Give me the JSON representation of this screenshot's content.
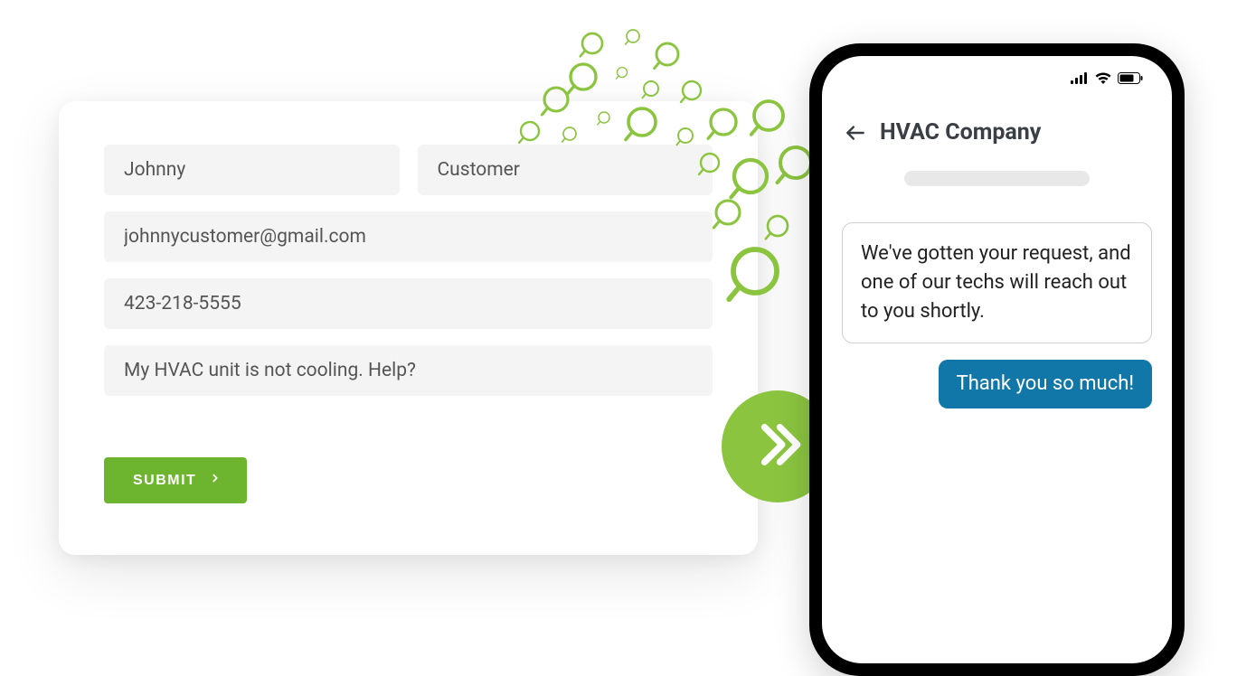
{
  "form": {
    "first_name": "Johnny",
    "last_name": "Customer",
    "email": "johnnycustomer@gmail.com",
    "phone": "423-218-5555",
    "message": "My HVAC unit is not cooling. Help?",
    "submit_label": "SUBMIT"
  },
  "chat": {
    "title": "HVAC Company",
    "incoming": "We've gotten your request, and one of our techs will reach out to you shortly.",
    "outgoing": "Thank you so much!"
  },
  "colors": {
    "accent_green": "#8bc540",
    "button_green": "#6eb52f",
    "chat_blue": "#1177a8"
  }
}
